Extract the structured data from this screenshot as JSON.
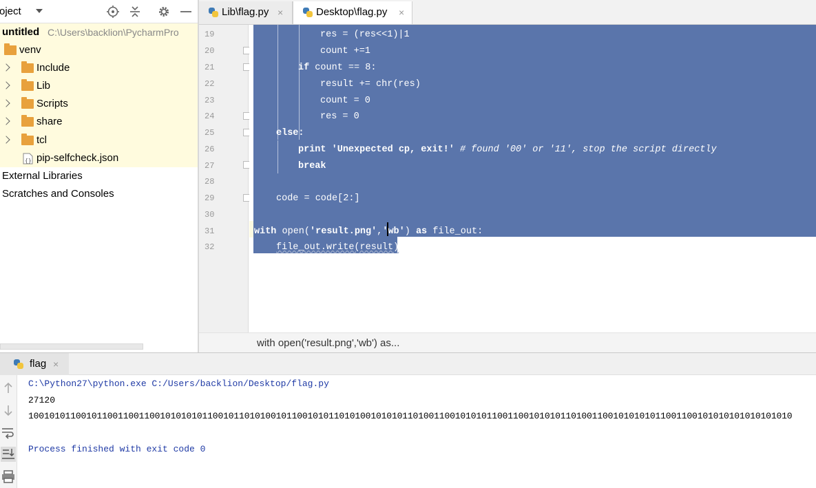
{
  "project_panel": {
    "title": "roject",
    "root": {
      "name": "untitled",
      "path": "C:\\Users\\backlion\\PycharmPro"
    },
    "items": [
      {
        "label": "venv"
      },
      {
        "label": "Include"
      },
      {
        "label": "Lib"
      },
      {
        "label": "Scripts"
      },
      {
        "label": "share"
      },
      {
        "label": "tcl"
      },
      {
        "label": "pip-selfcheck.json"
      },
      {
        "label": "External Libraries"
      },
      {
        "label": "Scratches and Consoles"
      }
    ]
  },
  "editor": {
    "tabs": [
      {
        "label": "Lib\\flag.py",
        "close": "×"
      },
      {
        "label": "Desktop\\flag.py",
        "close": "×"
      }
    ],
    "line_numbers": [
      "19",
      "20",
      "21",
      "22",
      "23",
      "24",
      "25",
      "26",
      "27",
      "28",
      "29",
      "30",
      "31",
      "32"
    ],
    "lines": {
      "l19": "res = (res<<1)|1",
      "l20": "count +=1",
      "l21_kw": "if",
      "l21_rest": " count == 8:",
      "l22": "result += chr(res)",
      "l23": "count = 0",
      "l24": "res = 0",
      "l25": "else:",
      "l26_kw": "print",
      "l26_str": " 'Unexpected cp, exit!'",
      "l26_cmt": " # found '00' or '11', stop the script directly",
      "l27": "break",
      "l29": "code = code[2:]",
      "l31_kw": "with",
      "l31_mid": " open(",
      "l31_s1": "'result.png'",
      "l31_comma": ",",
      "l31_s2": "'wb'",
      "l31_close": ") ",
      "l31_as": "as",
      "l31_end": " file_out:",
      "l32": "file_out.write(result)"
    },
    "breadcrumb": "with open('result.png','wb') as..."
  },
  "run_window": {
    "tab_label": "flag",
    "tab_close": "×",
    "console": [
      "C:\\Python27\\python.exe C:/Users/backlion/Desktop/flag.py",
      "27120",
      "1001010110010110011001100101010101100101101010010110010101101010010101011010011001010101100110010101011010011001010101011001100101010101010101010",
      "Process finished with exit code 0"
    ]
  },
  "colors": {
    "selection": "#5a75ab",
    "tree_highlight": "#fffbde",
    "console_blue": "#1f3aa5"
  }
}
